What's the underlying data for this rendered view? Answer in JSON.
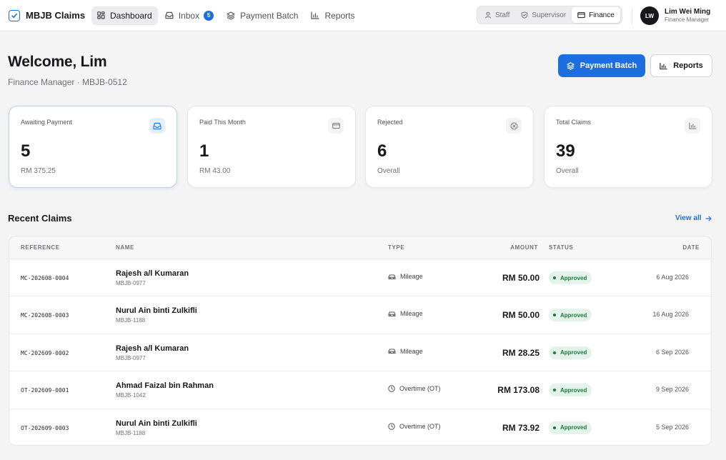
{
  "app": {
    "name": "MBJB Claims"
  },
  "nav": {
    "items": [
      {
        "label": "Dashboard",
        "icon": "grid-icon",
        "active": true
      },
      {
        "label": "Inbox",
        "icon": "inbox-icon",
        "badge": "5"
      },
      {
        "label": "Payment Batch",
        "icon": "layers-icon"
      },
      {
        "label": "Reports",
        "icon": "bar-chart-icon"
      }
    ]
  },
  "roles": [
    {
      "label": "Staff",
      "icon": "user-icon"
    },
    {
      "label": "Supervisor",
      "icon": "shield-icon"
    },
    {
      "label": "Finance",
      "icon": "wallet-icon",
      "active": true
    }
  ],
  "user": {
    "initials": "LW",
    "name": "Lim Wei Ming",
    "role": "Finance Manager"
  },
  "header": {
    "welcome": "Welcome, Lim",
    "subtitle": "Finance Manager · MBJB-0512",
    "primary_button": "Payment Batch",
    "secondary_button": "Reports"
  },
  "stats": [
    {
      "label": "Awaiting Payment",
      "value": "5",
      "sub": "RM 375.25",
      "icon": "inbox-icon"
    },
    {
      "label": "Paid This Month",
      "value": "1",
      "sub": "RM 43.00",
      "icon": "wallet-icon"
    },
    {
      "label": "Rejected",
      "value": "6",
      "sub": "Overall",
      "icon": "x-circle-icon"
    },
    {
      "label": "Total Claims",
      "value": "39",
      "sub": "Overall",
      "icon": "bar-chart-icon"
    }
  ],
  "recent": {
    "title": "Recent Claims",
    "view_all": "View all",
    "columns": [
      "REFERENCE",
      "NAME",
      "TYPE",
      "AMOUNT",
      "STATUS",
      "DATE"
    ],
    "rows": [
      {
        "reference": "MC-202608-0004",
        "name": "Rajesh a/l Kumaran",
        "staff_id": "MBJB-0977",
        "type": "Mileage",
        "type_icon": "car-icon",
        "amount": "RM 50.00",
        "status": "Approved",
        "date": "6 Aug 2026"
      },
      {
        "reference": "MC-202608-0003",
        "name": "Nurul Ain binti Zulkifli",
        "staff_id": "MBJB-1188",
        "type": "Mileage",
        "type_icon": "car-icon",
        "amount": "RM 50.00",
        "status": "Approved",
        "date": "16 Aug 2026"
      },
      {
        "reference": "MC-202609-0002",
        "name": "Rajesh a/l Kumaran",
        "staff_id": "MBJB-0977",
        "type": "Mileage",
        "type_icon": "car-icon",
        "amount": "RM 28.25",
        "status": "Approved",
        "date": "6 Sep 2026"
      },
      {
        "reference": "OT-202609-0001",
        "name": "Ahmad Faizal bin Rahman",
        "staff_id": "MBJB-1042",
        "type": "Overtime (OT)",
        "type_icon": "clock-icon",
        "amount": "RM 173.08",
        "status": "Approved",
        "date": "9 Sep 2026"
      },
      {
        "reference": "OT-202609-0003",
        "name": "Nurul Ain binti Zulkifli",
        "staff_id": "MBJB-1188",
        "type": "Overtime (OT)",
        "type_icon": "clock-icon",
        "amount": "RM 73.92",
        "status": "Approved",
        "date": "5 Sep 2026"
      }
    ]
  },
  "colors": {
    "accent": "#1d6fe0",
    "approved_bg": "#e5f4ea",
    "approved_text": "#1b7a3e",
    "background": "#f4f4f5"
  }
}
